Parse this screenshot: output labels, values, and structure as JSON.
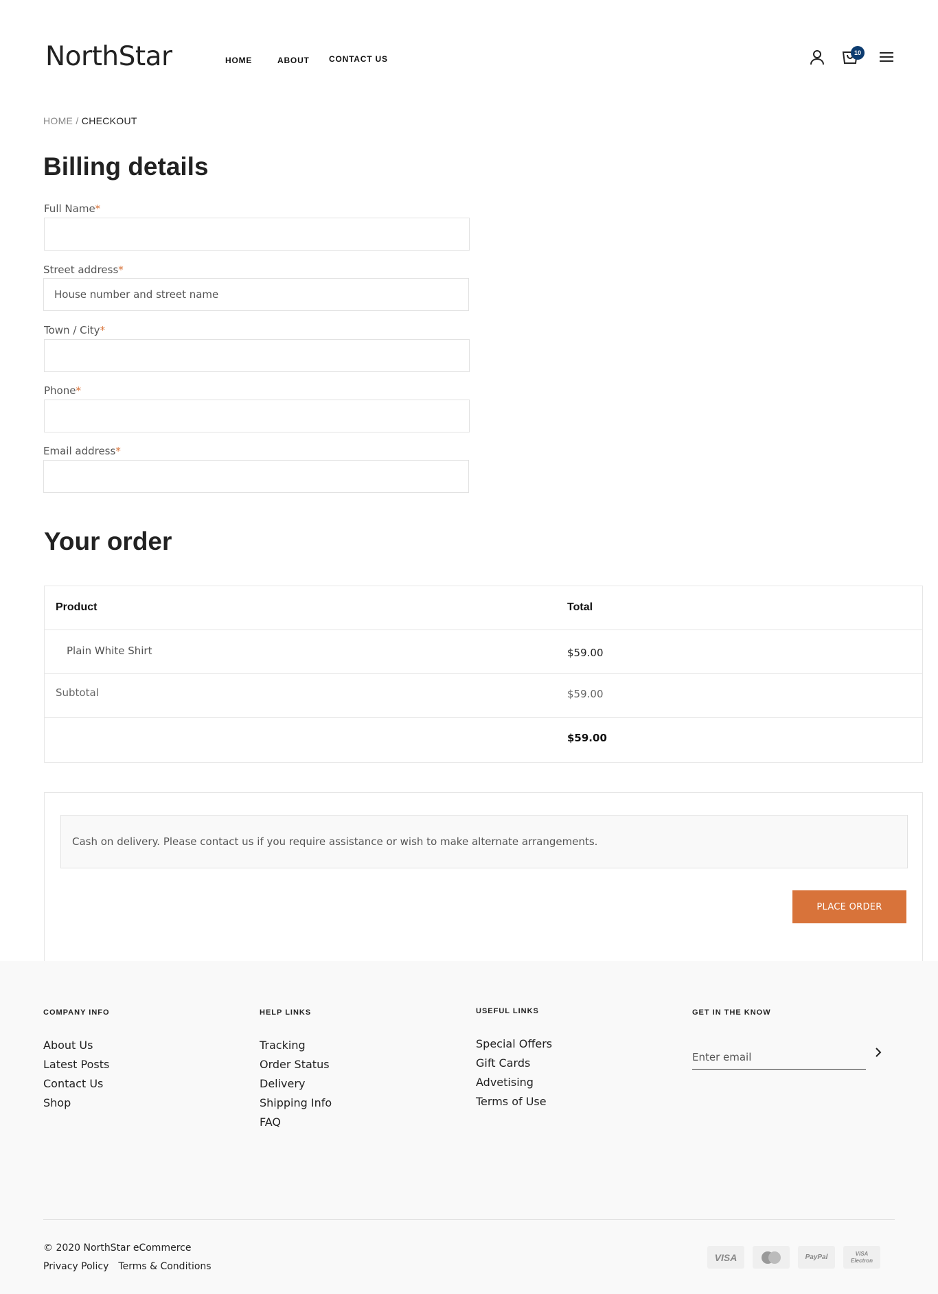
{
  "header": {
    "logo": "NorthStar",
    "nav": [
      "HOME",
      "ABOUT",
      "CONTACT US"
    ],
    "cart_count": "10",
    "icons": [
      "user-icon",
      "cart-icon",
      "menu-icon"
    ]
  },
  "breadcrumb": {
    "home": "HOME",
    "separator": " / ",
    "current": "CHECKOUT"
  },
  "billing": {
    "title": "Billing details",
    "fields": [
      {
        "label": "Full Name",
        "required": "*",
        "value": "",
        "placeholder": ""
      },
      {
        "label": "Street address",
        "required": "*",
        "value": "",
        "placeholder": "House number and street name"
      },
      {
        "label": "Town / City",
        "required": "*",
        "value": "",
        "placeholder": ""
      },
      {
        "label": "Phone",
        "required": "*",
        "value": "",
        "placeholder": ""
      },
      {
        "label": "Email address",
        "required": "*",
        "value": "",
        "placeholder": ""
      }
    ]
  },
  "order": {
    "title": "Your order",
    "headers": [
      "Product",
      "Total"
    ],
    "items": [
      {
        "name": "Plain White Shirt",
        "total": "$59.00"
      }
    ],
    "subtotal_label": "Subtotal",
    "subtotal": "$59.00",
    "total": "$59.00"
  },
  "payment": {
    "message": "Cash on delivery.  Please contact us if you require assistance or wish to make alternate arrangements.",
    "button": "PLACE ORDER",
    "accent_color": "#d8733a"
  },
  "footer": {
    "columns": [
      {
        "title": "COMPANY INFO",
        "links": [
          "About Us",
          "Latest Posts",
          "Contact Us",
          "Shop"
        ]
      },
      {
        "title": "HELP LINKS",
        "links": [
          "Tracking",
          "Order Status",
          "Delivery",
          "Shipping Info",
          "FAQ"
        ]
      },
      {
        "title": "USEFUL LINKS",
        "links": [
          "Special Offers",
          "Gift Cards",
          "Advetising",
          "Terms of Use"
        ]
      }
    ],
    "newsletter": {
      "title": "GET IN THE KNOW",
      "placeholder": "Enter email"
    },
    "copyright": "© 2020 NorthStar eCommerce",
    "legal": [
      "Privacy Policy",
      "Terms & Conditions"
    ],
    "payment_icons": [
      "VISA",
      "MasterCard",
      "PayPal",
      "VISA Electron"
    ]
  }
}
